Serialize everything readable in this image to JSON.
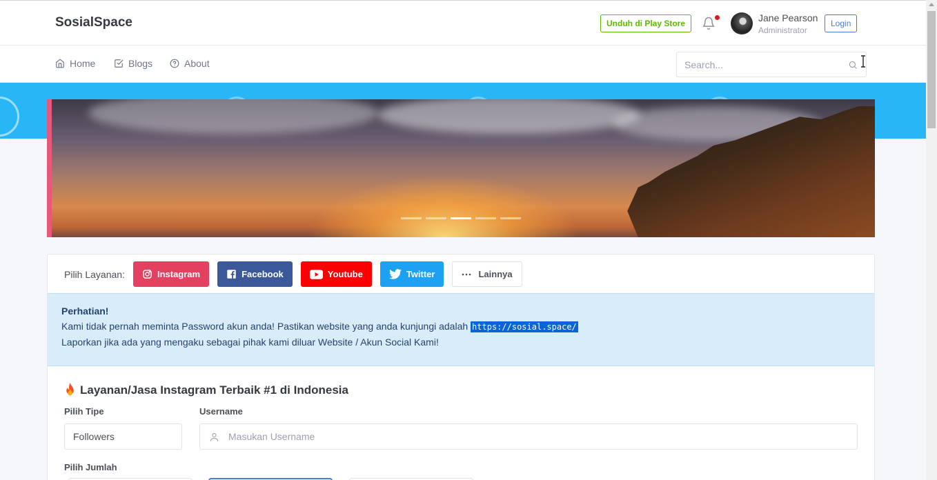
{
  "header": {
    "brand": "SosialSpace",
    "play_store_label": "Unduh di Play Store",
    "user_name": "Jane Pearson",
    "user_role": "Administrator",
    "login_label": "Login"
  },
  "nav": {
    "items": [
      {
        "label": "Home",
        "icon": "home-icon"
      },
      {
        "label": "Blogs",
        "icon": "check-square-icon"
      },
      {
        "label": "About",
        "icon": "help-circle-icon"
      }
    ],
    "search_placeholder": "Search..."
  },
  "carousel": {
    "slide_count": 5,
    "active_index": 2
  },
  "services": {
    "label": "Pilih Layanan:",
    "buttons": [
      {
        "label": "Instagram",
        "color": "#e4405f"
      },
      {
        "label": "Facebook",
        "color": "#3b5998"
      },
      {
        "label": "Youtube",
        "color": "#ff0000"
      },
      {
        "label": "Twitter",
        "color": "#1da1f2"
      },
      {
        "label": "Lainnya",
        "color": "#ffffff"
      }
    ]
  },
  "alert": {
    "title": "Perhatian!",
    "line1": "Kami tidak pernah meminta Password akun anda! Pastikan website yang anda kunjungi adalah",
    "url": "https://sosial.space/",
    "line2": "Laporkan jika ada yang mengaku sebagai pihak kami diluar Website / Akun Social Kami!"
  },
  "form": {
    "title": "Layanan/Jasa Instagram Terbaik #1 di Indonesia",
    "type_label": "Pilih Tipe",
    "type_value": "Followers",
    "username_label": "Username",
    "username_placeholder": "Masukan Username",
    "amount_label": "Pilih Jumlah"
  }
}
